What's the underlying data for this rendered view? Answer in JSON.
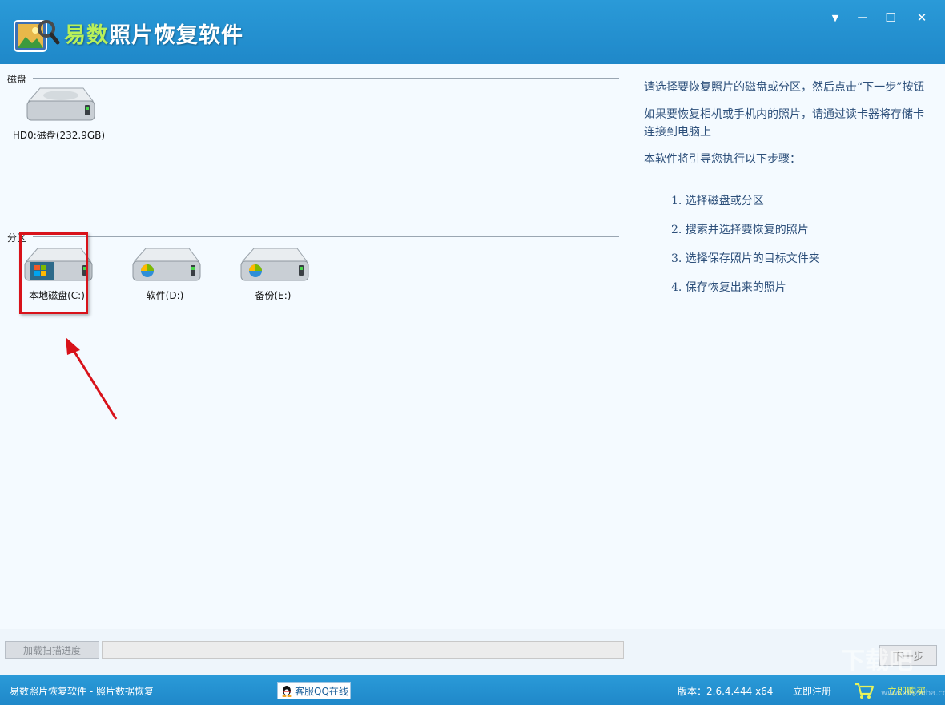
{
  "app": {
    "title_part1": "易数",
    "title_part2": "照片恢复软件",
    "colors": {
      "titlebar": "#2a9ad8",
      "title_highlight": "#b8f05a",
      "highlight_box": "#d8121a",
      "instructions_text": "#2c4f7a"
    }
  },
  "window_controls": {
    "menu_icon": "▼",
    "minimize_icon": "—",
    "maximize_icon": "☐",
    "close_icon": "✕"
  },
  "disks": {
    "group_label": "磁盘",
    "items": [
      {
        "label": "HD0:磁盘(232.9GB)",
        "icon": "hard-disk-icon"
      }
    ]
  },
  "partitions": {
    "group_label": "分区",
    "items": [
      {
        "label": "本地磁盘(C:)",
        "icon": "windows-drive-icon",
        "selected": true
      },
      {
        "label": "软件(D:)",
        "icon": "drive-icon"
      },
      {
        "label": "备份(E:)",
        "icon": "drive-icon"
      }
    ]
  },
  "instructions": {
    "para1": "请选择要恢复照片的磁盘或分区，然后点击“下一步”按钮",
    "para2": "如果要恢复相机或手机内的照片，请通过读卡器将存储卡连接到电脑上",
    "para3": "本软件将引导您执行以下步骤：",
    "steps": [
      "1.  选择磁盘或分区",
      "2.  搜索并选择要恢复的照片",
      "3.  选择保存照片的目标文件夹",
      "4.  保存恢复出来的照片"
    ]
  },
  "bottom": {
    "load_progress_label": "加载扫描进度",
    "next_label": "下一步"
  },
  "status": {
    "left_text": "易数照片恢复软件 - 照片数据恢复",
    "qq_label": "客服QQ在线",
    "version_text": "版本：2.6.4.444 x64",
    "register_label": "立即注册",
    "buy_label": "立即购买"
  },
  "watermark": {
    "main": "下载吧",
    "sub": "www.xiazaiba.com"
  }
}
